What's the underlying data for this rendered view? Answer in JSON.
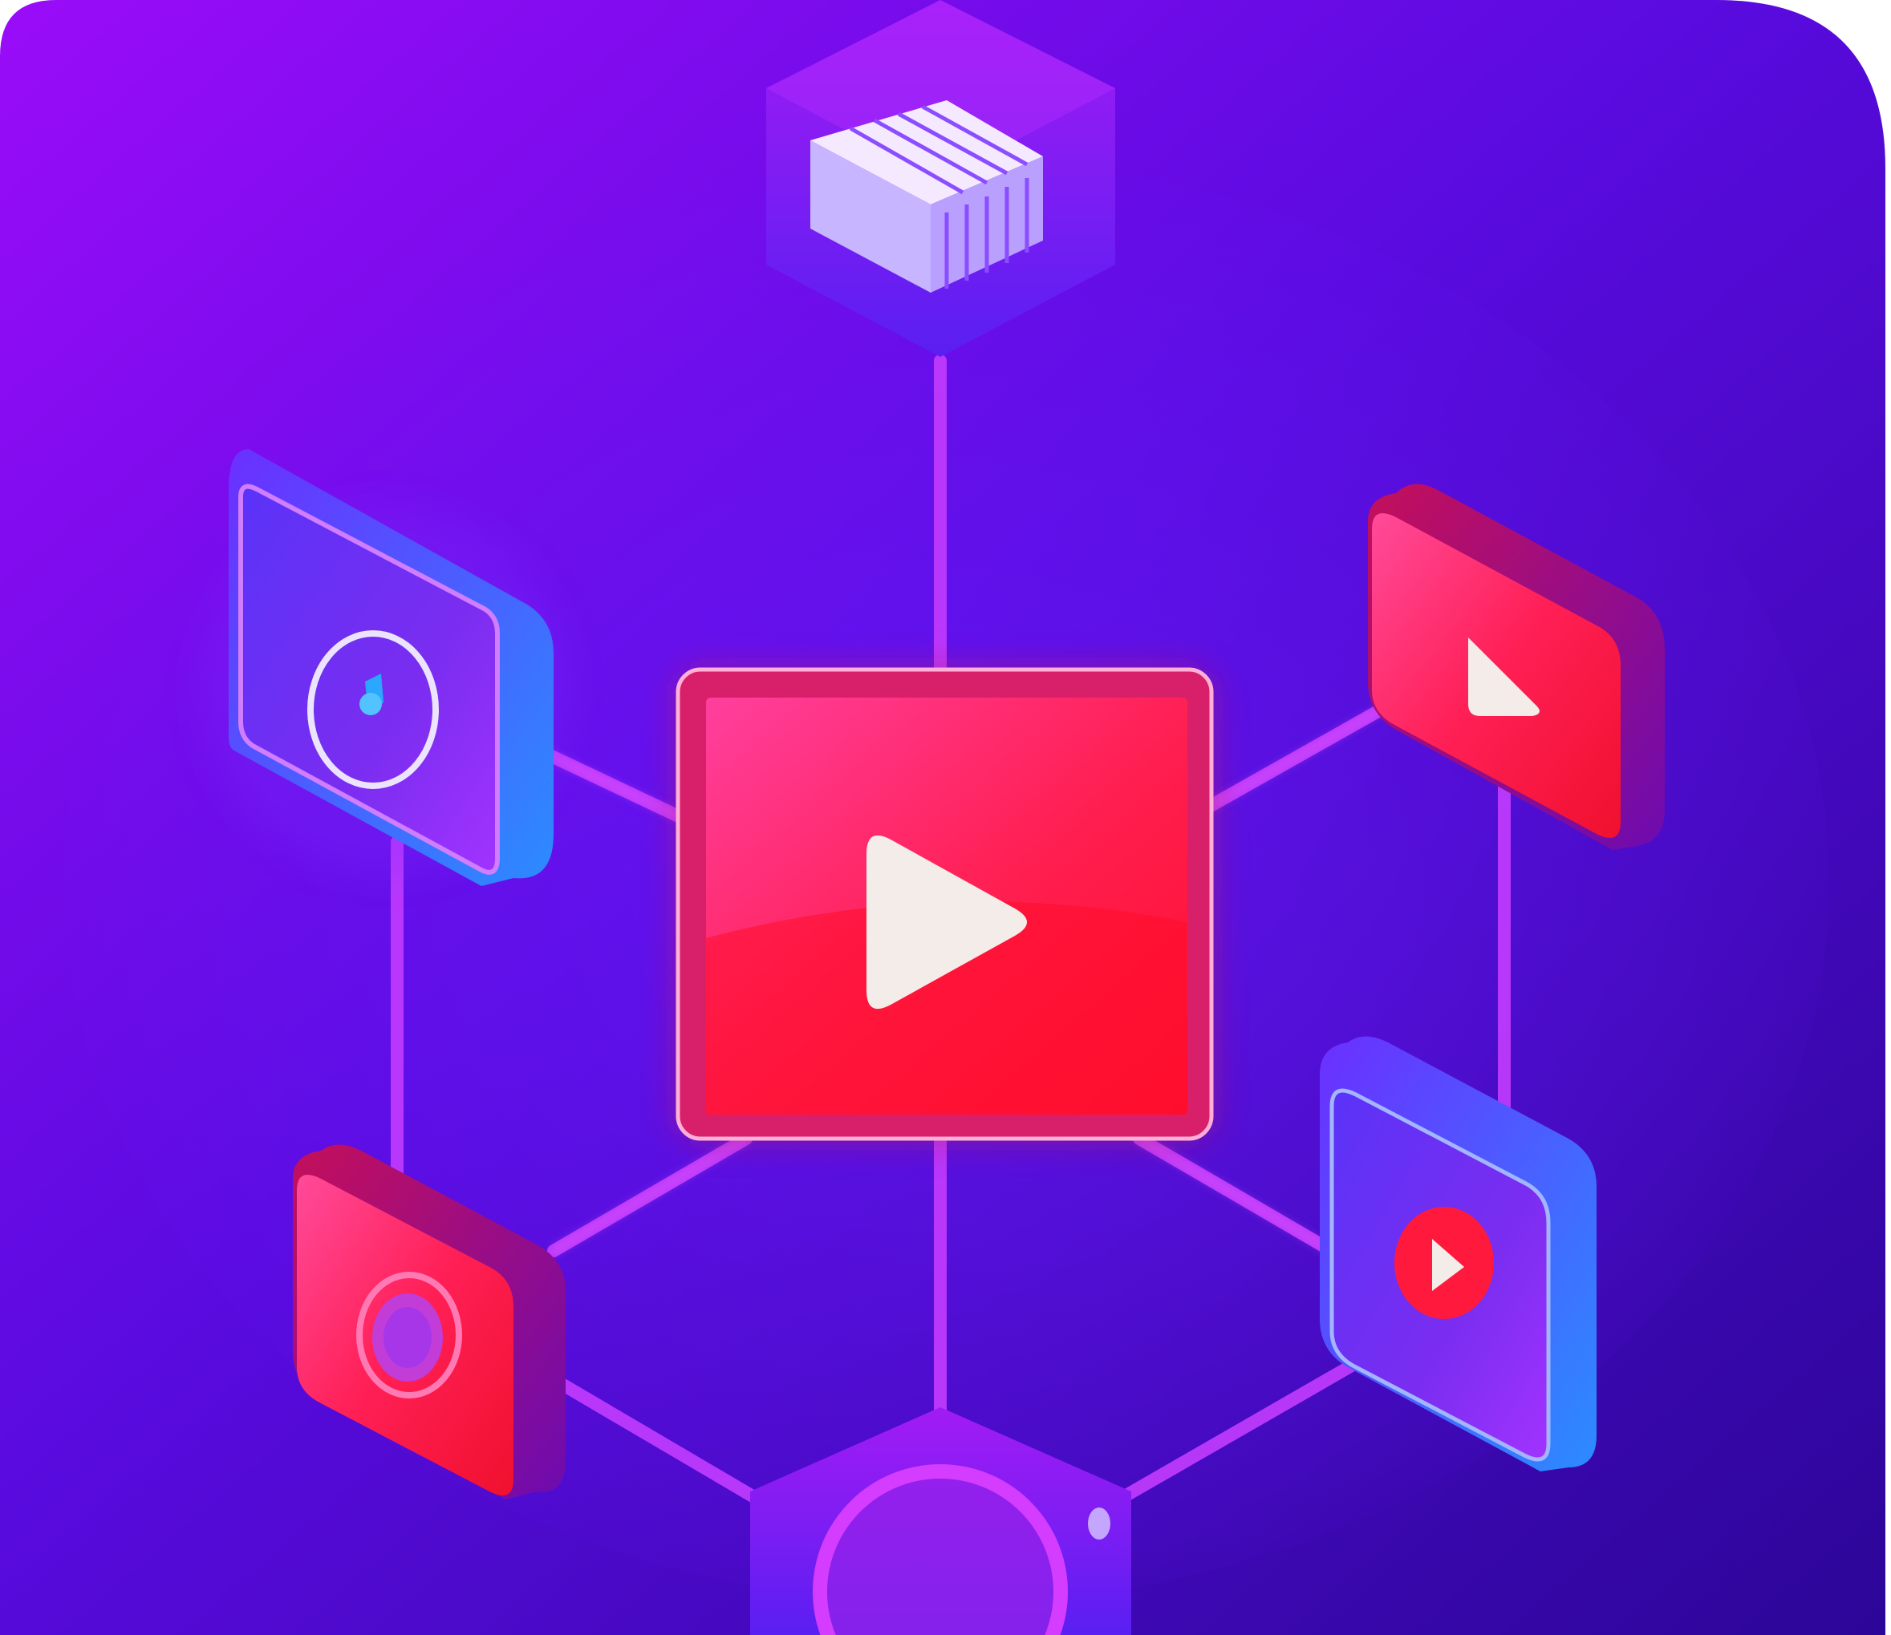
{
  "illustration": {
    "colors": {
      "bg_top_left": "#8f0cf5",
      "bg_mid": "#4b0bd8",
      "bg_bottom_right": "#2a0796",
      "connector": "#c13cff",
      "accent_red": "#ff1744",
      "accent_pink": "#ff3a8c",
      "tile_blue": "#4a2df2",
      "play_glyph": "#f3ece8"
    },
    "nodes": [
      {
        "name": "top-cube",
        "icon": "film-strip-icon"
      },
      {
        "name": "left-top-tile",
        "icon": "music-disc-icon"
      },
      {
        "name": "right-top-tile",
        "icon": "play-icon"
      },
      {
        "name": "center-screen",
        "icon": "play-icon"
      },
      {
        "name": "left-bottom-tile",
        "icon": "camera-lens-icon"
      },
      {
        "name": "right-bottom-tile",
        "icon": "play-circle-icon"
      },
      {
        "name": "bottom-hex",
        "icon": "ring-icon"
      }
    ]
  }
}
